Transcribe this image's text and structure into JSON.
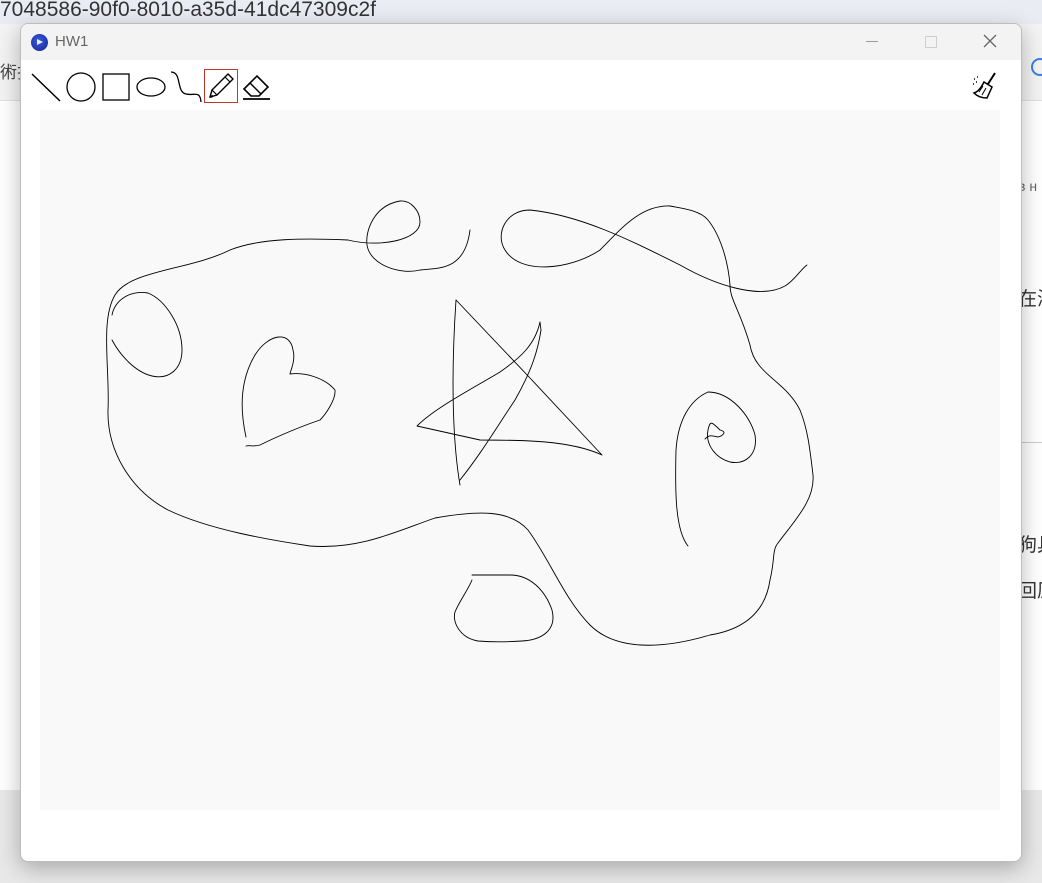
{
  "background": {
    "url_fragment": "7048586-90f0-8010-a35d-41dc47309c2f",
    "left_fragment": "術拉",
    "right_fragments": [
      "в н",
      "在海",
      "狗具",
      "回原"
    ]
  },
  "window": {
    "title": "HW1",
    "app_icon": "circle-play-icon",
    "controls": [
      "minimize-icon",
      "maximize-icon",
      "close-icon"
    ]
  },
  "toolbar": {
    "tools": [
      {
        "name": "line-tool",
        "icon": "line-icon",
        "selected": false
      },
      {
        "name": "circle-tool",
        "icon": "circle-icon",
        "selected": false
      },
      {
        "name": "rectangle-tool",
        "icon": "rectangle-icon",
        "selected": false
      },
      {
        "name": "ellipse-tool",
        "icon": "ellipse-icon",
        "selected": false
      },
      {
        "name": "curve-tool",
        "icon": "curve-icon",
        "selected": false
      },
      {
        "name": "pencil-tool",
        "icon": "pencil-icon",
        "selected": true
      },
      {
        "name": "eraser-tool",
        "icon": "eraser-icon",
        "selected": false
      }
    ],
    "clear": {
      "name": "clear-canvas-button",
      "icon": "broom-icon"
    }
  },
  "canvas": {
    "background": "#f9f9f9",
    "stroke_color": "#000000"
  },
  "colors": {
    "selected_outline": "#c0392b",
    "app_icon": "#1f2fa8"
  }
}
